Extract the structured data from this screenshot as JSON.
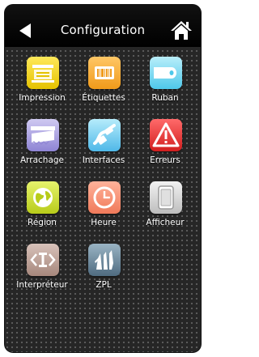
{
  "header": {
    "title": "Configuration",
    "back_icon": "back-arrow-icon",
    "home_icon": "home-icon"
  },
  "menu": {
    "items": [
      {
        "label": "Impression",
        "icon": "print-icon",
        "color": "#f5d41c"
      },
      {
        "label": "Étiquettes",
        "icon": "label-icon",
        "color": "#f5ad2e"
      },
      {
        "label": "Ruban",
        "icon": "ribbon-icon",
        "color": "#6fd3ef"
      },
      {
        "label": "Arrachage",
        "icon": "tear-off-icon",
        "color": "#a59ce0"
      },
      {
        "label": "Interfaces",
        "icon": "interfaces-icon",
        "color": "#60c3ec"
      },
      {
        "label": "Erreurs",
        "icon": "warning-icon",
        "color": "#e23030"
      },
      {
        "label": "Région",
        "icon": "globe-icon",
        "color": "#cadc2a"
      },
      {
        "label": "Heure",
        "icon": "clock-icon",
        "color": "#f68c6a"
      },
      {
        "label": "Afficheur",
        "icon": "display-icon",
        "color": "#d4d4d4"
      },
      {
        "label": "Interpréteur",
        "icon": "interpreter-icon",
        "color": "#b99a8f"
      },
      {
        "label": "ZPL",
        "icon": "zebra-icon",
        "color": "#6b8aa0"
      }
    ]
  }
}
